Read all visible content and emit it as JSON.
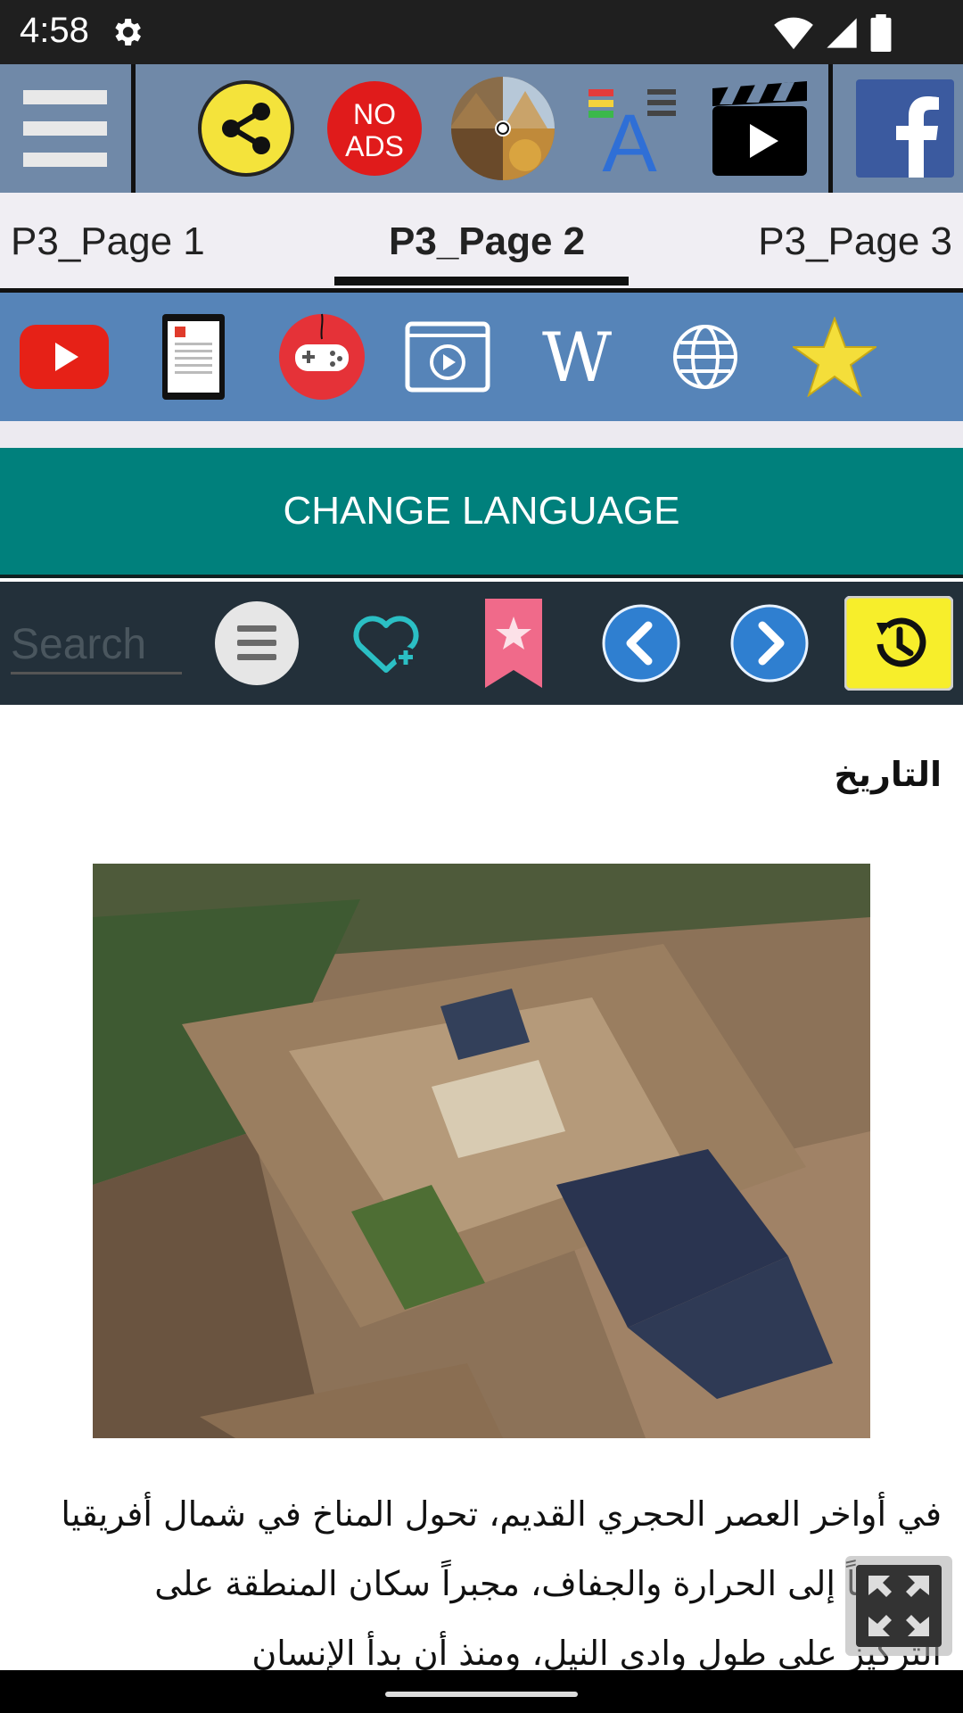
{
  "status_bar": {
    "time": "4:58"
  },
  "tabs": [
    {
      "label": "P3_Page 1"
    },
    {
      "label": "P3_Page 2"
    },
    {
      "label": "P3_Page 3"
    }
  ],
  "toolbar": {
    "no_ads_line1": "NO",
    "no_ads_line2": "ADS"
  },
  "language_button": {
    "label": "CHANGE LANGUAGE"
  },
  "search": {
    "placeholder": "Search"
  },
  "content": {
    "title": "التاريخ",
    "image_alt": "Aerial reconstruction of an ancient walled temple city beside the Nile",
    "paragraph": "في أواخر العصر الحجري القديم، تحول المناخ في شمال أفريقيا تدريجياً إلى الحرارة والجفاف، مجبراً سكان المنطقة على التركيز على طول وادي النيل، ومنذ أن بدأ الإنسان"
  },
  "colors": {
    "toolbar_bg": "#7089a8",
    "icon_row_bg": "#5684b8",
    "language_bg": "#00807c",
    "search_bar_bg": "#23303a"
  }
}
